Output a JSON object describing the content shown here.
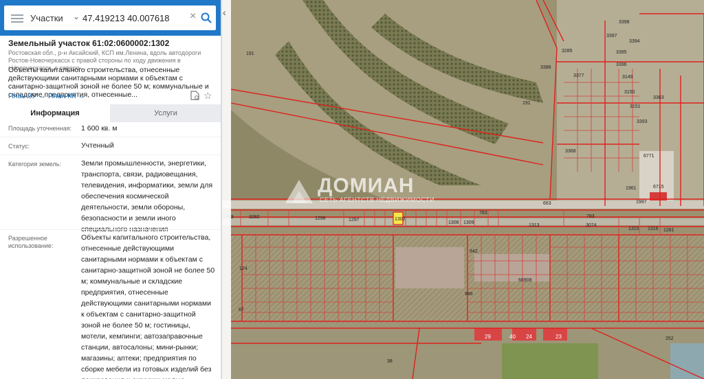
{
  "search": {
    "layer": "Участки",
    "coordinates": "47.419213 40.007618"
  },
  "parcel": {
    "title": "Земельный участок 61:02:0600002:1302",
    "address": "Ростовская обл., р-н Аксайский, КСП им.Ленина, вдоль автодороги Ростов-Новочеркасск с правой стороны по ходу движения в г.Новочеркасск, с северо-...",
    "description": "Объекты капитального строительства, отнесенные действующими санитарными нормами к объектам с санитарно-защитной зоной не более 50 м; коммунальные и складские предприятия, отнесенные...",
    "link_plan_zu": "План ЗУ →",
    "link_plan_kk": "План КК →"
  },
  "tabs": {
    "info": "Информация",
    "services": "Услуги"
  },
  "details": [
    {
      "label": "Площадь уточненная:",
      "value": "1 600 кв. м"
    },
    {
      "label": "Статус:",
      "value": "Учтенный"
    },
    {
      "label": "Категория земель:",
      "value": "Земли промышленности, энергетики, транспорта, связи, радиовещания, телевидения, информатики, земли для обеспечения космической деятельности, земли обороны, безопасности и земли иного специального назначения"
    },
    {
      "label": "Разрешенное использование:",
      "value": "Объекты капитального строительства, отнесенные действующими санитарными нормами к объектам с санитарно-защитной зоной не более 50 м; коммунальные и складские предприятия, отнесенные действующими санитарными нормами к объектам с санитарно-защитной зоной не более 50 м; гостиницы, мотели, кемпинги; автозаправочные станции, автосалоны; мини-рынки; магазины; аптеки; предприятия по сборке мебели из готовых изделий без лакирования и окраски; малые предприятия и цеха малой мощности:"
    }
  ],
  "watermark": {
    "brand": "ДОМИАН",
    "tagline": "СЕТЬ АГЕНТСТВ НЕДВИЖИМОСТИ"
  },
  "map_labels": {
    "top": [
      "3398",
      "3397",
      "3394",
      "3395",
      "3396",
      "3285",
      "3386",
      "3377",
      "3149",
      "3150",
      "3151",
      "3393",
      "3363",
      "191",
      "191",
      "3368",
      "6771",
      "6715",
      "663",
      "783",
      "783",
      "3074",
      "1313",
      "1315",
      "1316",
      "1281",
      "1293",
      "3282",
      "1296",
      "1297",
      "1308",
      "1309",
      "124",
      "67",
      "942",
      "946",
      "66908",
      "29",
      "40",
      "24",
      "23",
      "252",
      "38",
      "1961",
      "1997"
    ],
    "highlight": "1302"
  },
  "colors": {
    "header": "#1f78c8",
    "parcel_line": "#e0201c",
    "highlight": "#f5e84a",
    "link": "#1f6fb4"
  },
  "icons": [
    "menu-icon",
    "chevron-down-icon",
    "close-icon",
    "search-icon",
    "chevron-left-icon",
    "pdf-icon",
    "star-icon",
    "arrow-right-icon"
  ]
}
